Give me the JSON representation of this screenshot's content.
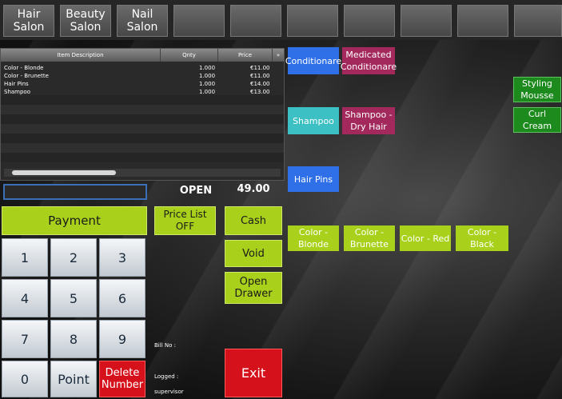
{
  "categories": [
    {
      "label": "Hair\nSalon"
    },
    {
      "label": "Beauty\nSalon"
    },
    {
      "label": "Nail\nSalon"
    },
    {
      "label": ""
    },
    {
      "label": ""
    },
    {
      "label": ""
    },
    {
      "label": ""
    },
    {
      "label": ""
    },
    {
      "label": ""
    },
    {
      "label": ""
    }
  ],
  "table": {
    "headers": {
      "desc": "Item Description",
      "qty": "Qnty",
      "price": "Price"
    },
    "rows": [
      {
        "desc": "Color - Blonde",
        "qty": "1.000",
        "price": "€11.00"
      },
      {
        "desc": "Color - Brunette",
        "qty": "1.000",
        "price": "€11.00"
      },
      {
        "desc": "Hair Pins",
        "qty": "1.000",
        "price": "€14.00"
      },
      {
        "desc": "Shampoo",
        "qty": "1.000",
        "price": "€13.00"
      }
    ]
  },
  "status": "OPEN",
  "total": "49.00",
  "buttons": {
    "payment": "Payment",
    "price_list": "Price List\nOFF",
    "cash": "Cash",
    "void": "Void",
    "open_drawer": "Open\nDrawer",
    "exit": "Exit",
    "point": "Point",
    "delete_number": "Delete\nNumber"
  },
  "keypad": [
    "1",
    "2",
    "3",
    "4",
    "5",
    "6",
    "7",
    "8",
    "9",
    "0"
  ],
  "info": {
    "bill_no": "Bill No :",
    "logged": "Logged :",
    "user": "supervisor"
  },
  "products": {
    "conditionare": "Conditionare",
    "medicated_conditionare": "Medicated\nConditionare",
    "styling_mousse": "Styling\nMousse",
    "curl_cream": "Curl Cream",
    "shampoo": "Shampoo",
    "shampoo_dry_hair": "Shampoo -\nDry Hair",
    "hair_pins": "Hair Pins",
    "color_blonde": "Color -\nBlonde",
    "color_brunette": "Color -\nBrunette",
    "color_red": "Color - Red",
    "color_black": "Color - Black"
  },
  "colors": {
    "lime": "#a9d11b",
    "exit_red": "#d5121b",
    "blue": "#2f6fe8",
    "magenta": "#a3285c",
    "teal": "#3cc0c4",
    "green": "#1d8a1d"
  }
}
